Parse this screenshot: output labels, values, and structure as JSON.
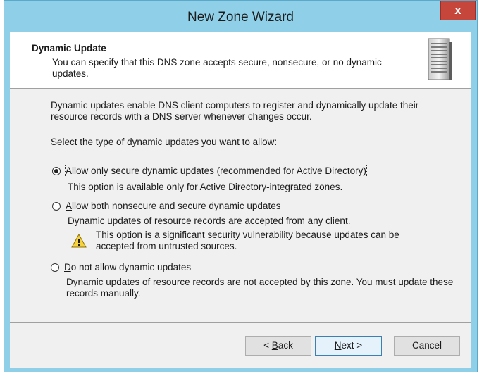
{
  "window": {
    "title": "New Zone Wizard",
    "close_label": "x"
  },
  "header": {
    "title": "Dynamic Update",
    "subtitle": "You can specify that this DNS zone accepts secure, nonsecure, or no dynamic updates."
  },
  "body": {
    "intro": "Dynamic updates enable DNS client computers to register and dynamically update their resource records with a DNS server whenever changes occur.",
    "prompt": "Select the type of dynamic updates you want to allow:",
    "options": [
      {
        "label_pre": "Allow only ",
        "label_key": "s",
        "label_post": "ecure dynamic updates (recommended for Active Directory)",
        "description": "This option is available only for Active Directory-integrated zones.",
        "selected": true
      },
      {
        "label_pre": "",
        "label_key": "A",
        "label_post": "llow both nonsecure and secure dynamic updates",
        "description": "Dynamic updates of resource records are accepted from any client.",
        "warning": "This option is a significant security vulnerability because updates can be accepted from untrusted sources.",
        "selected": false
      },
      {
        "label_pre": "",
        "label_key": "D",
        "label_post": "o not allow dynamic updates",
        "description": "Dynamic updates of resource records are not accepted by this zone. You must update these records manually.",
        "selected": false
      }
    ]
  },
  "buttons": {
    "back_pre": "< ",
    "back_key": "B",
    "back_post": "ack",
    "next_pre": "",
    "next_key": "N",
    "next_post": "ext >",
    "cancel": "Cancel"
  },
  "colors": {
    "frame": "#8fcfe8",
    "close": "#c7463c",
    "client": "#f0f0f0"
  }
}
